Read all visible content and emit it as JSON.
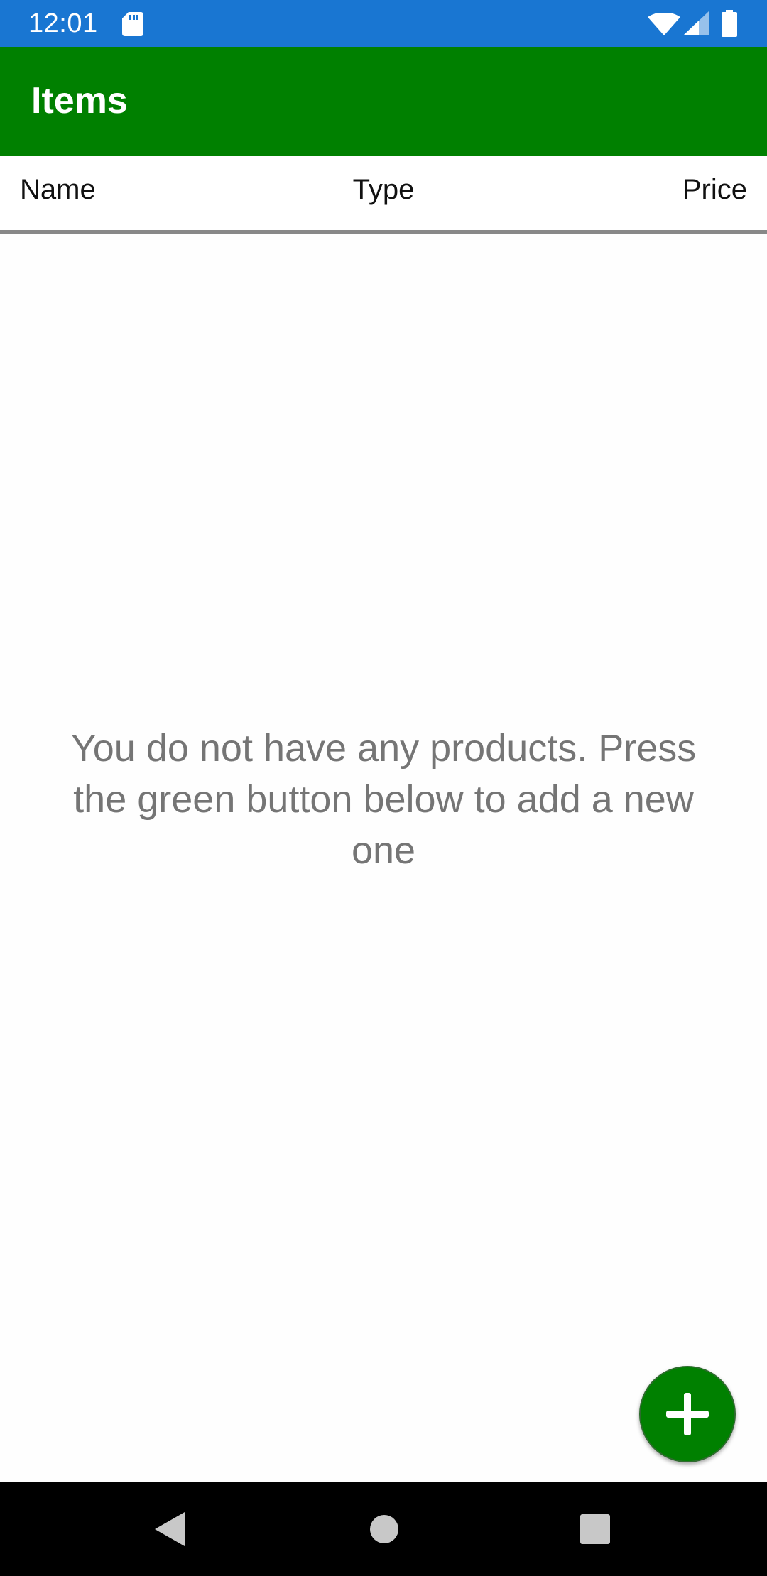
{
  "status_bar": {
    "time": "12:01",
    "icons": [
      "sd-card-icon",
      "wifi-icon",
      "cell-signal-icon",
      "battery-icon"
    ],
    "background": "#1976d2"
  },
  "app_bar": {
    "title": "Items",
    "background": "#008000"
  },
  "table_header": {
    "columns": [
      "Name",
      "Type",
      "Price"
    ]
  },
  "empty_state": {
    "message": "You do not have any products. Press the green button below to add a new one"
  },
  "fab": {
    "icon": "plus-icon",
    "color": "#008000"
  },
  "nav_bar": {
    "buttons": [
      "back-icon",
      "home-icon",
      "recents-icon"
    ]
  }
}
